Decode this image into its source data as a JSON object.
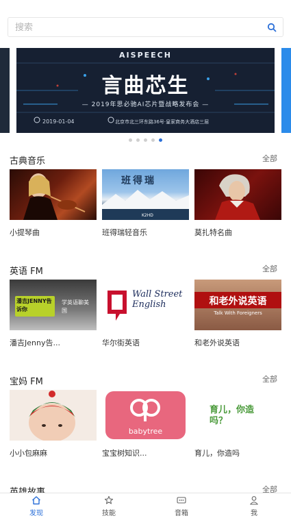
{
  "search": {
    "placeholder": "搜索",
    "icon": "search-icon"
  },
  "banner": {
    "brand": "AISPEECH",
    "headline": "言曲芯生",
    "subtitle": "— 2019年思必驰AI芯片暨战略发布会 —",
    "date": "2019-01-04",
    "address": "北京市北三环东路36号·皇家商务大酒店三层",
    "dots_total": 5,
    "dots_active_index": 4
  },
  "colors": {
    "accent": "#2a6fd8"
  },
  "sections": [
    {
      "title": "古典音乐",
      "all_label": "全部",
      "items": [
        {
          "caption": "小提琴曲"
        },
        {
          "caption": "班得瑞轻音乐",
          "image_text": "班得瑞",
          "image_badge": "K2HD"
        },
        {
          "caption": "莫扎特名曲"
        }
      ]
    },
    {
      "title": "英语 FM",
      "all_label": "全部",
      "items": [
        {
          "caption": "潘吉Jenny告...",
          "image_text": "潘吉JENNY告诉你",
          "image_text2": "学英语聊美国"
        },
        {
          "caption": "华尔街英语",
          "image_text": "Wall Street English"
        },
        {
          "caption": "和老外说英语",
          "image_text": "和老外说英语",
          "image_text2": "Talk With Foreigners"
        }
      ]
    },
    {
      "title": "宝妈 FM",
      "all_label": "全部",
      "items": [
        {
          "caption": "小小包麻麻"
        },
        {
          "caption": "宝宝树知识...",
          "image_text": "babytree"
        },
        {
          "caption": "育儿，你造吗",
          "image_text": "育儿，你造吗？"
        }
      ]
    },
    {
      "title": "英雄故事",
      "all_label": "全部"
    }
  ],
  "tabbar": [
    {
      "label": "发现",
      "icon": "home-icon",
      "active": true
    },
    {
      "label": "技能",
      "icon": "star-icon"
    },
    {
      "label": "音箱",
      "icon": "speaker-icon"
    },
    {
      "label": "我",
      "icon": "user-icon"
    }
  ]
}
